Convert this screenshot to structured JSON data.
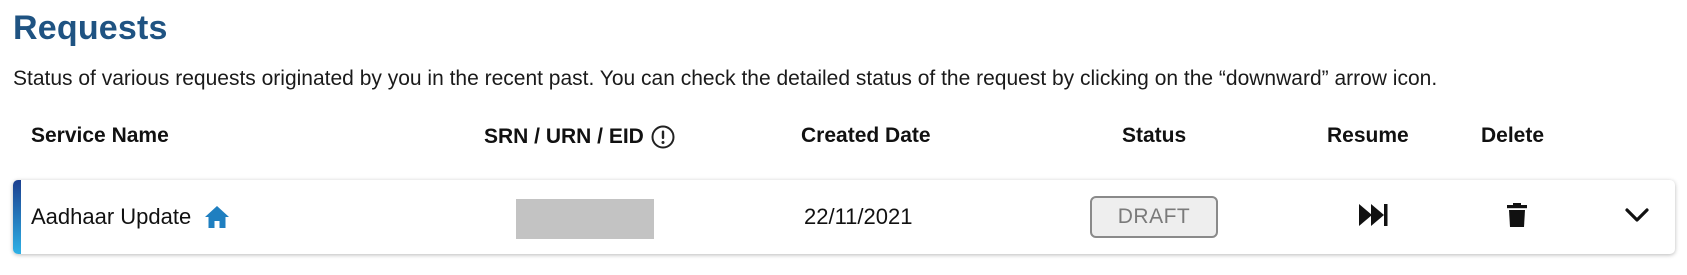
{
  "page": {
    "title": "Requests",
    "description": "Status of various requests originated by you in the recent past. You can check the detailed status of the request by clicking on the “downward” arrow icon."
  },
  "table": {
    "headers": {
      "service_name": "Service Name",
      "srn": "SRN / URN / EID",
      "created_date": "Created Date",
      "status": "Status",
      "resume": "Resume",
      "delete": "Delete"
    },
    "rows": [
      {
        "service_name": "Aadhaar Update",
        "service_icon": "home-icon",
        "srn_redacted": true,
        "created_date": "22/11/2021",
        "status": "DRAFT",
        "resume_icon": "fast-forward-icon",
        "delete_icon": "trash-icon",
        "expand_icon": "chevron-down-icon"
      }
    ]
  },
  "colors": {
    "title": "#1f5382",
    "accent_top": "#1c3f8f",
    "accent_bottom": "#2eb1e6",
    "home_icon": "#1f7fc0",
    "status_border": "#8a8a8a",
    "redaction": "#c3c3c3"
  },
  "icons": {
    "srn_info": "info-circle-icon"
  }
}
